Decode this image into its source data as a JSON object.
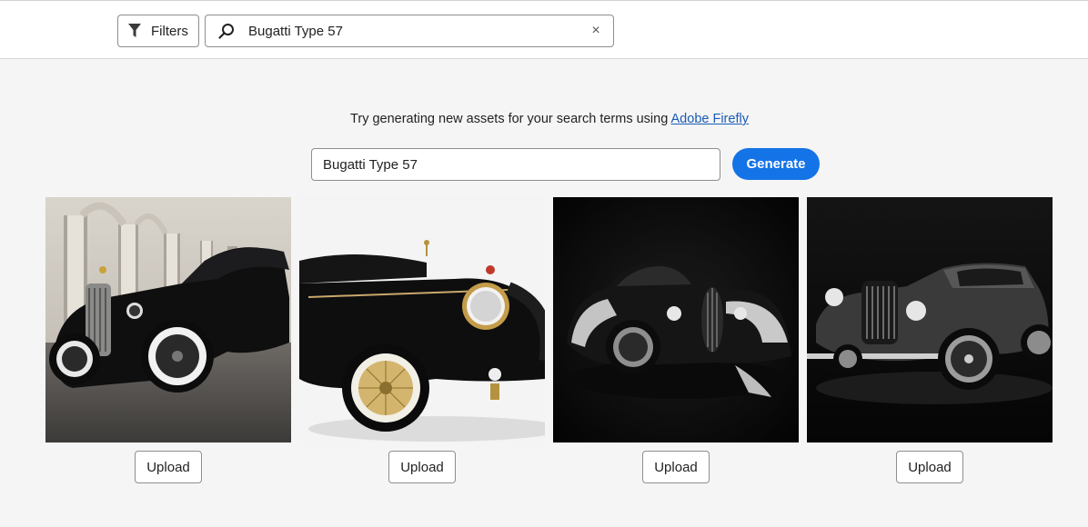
{
  "toolbar": {
    "filters_label": "Filters",
    "search_value": "Bugatti Type 57",
    "clear_symbol": "×"
  },
  "firefly": {
    "prompt_text": "Try generating new assets for your search terms using ",
    "link_text": "Adobe Firefly",
    "input_value": "Bugatti Type 57",
    "generate_label": "Generate",
    "accent_color": "#1473e6"
  },
  "results": [
    {
      "upload_label": "Upload",
      "scene": "classic black roadster by stone arcade"
    },
    {
      "upload_label": "Upload",
      "scene": "black vintage car with gold wire wheels on white"
    },
    {
      "upload_label": "Upload",
      "scene": "black art-deco coupe on dark background"
    },
    {
      "upload_label": "Upload",
      "scene": "silver and black vintage coupe on dark background"
    }
  ]
}
